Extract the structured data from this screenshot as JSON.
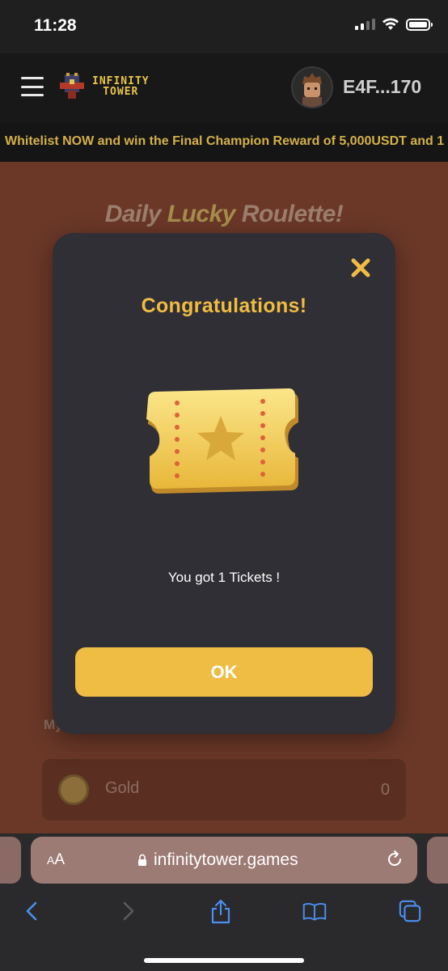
{
  "status_bar": {
    "time": "11:28"
  },
  "header": {
    "logo_line1": "INFINITY",
    "logo_line2": "TOWER",
    "wallet_address": "E4F...170"
  },
  "ticker": {
    "text": "Whitelist NOW and win the Final Champion Reward of 5,000USDT and 1"
  },
  "page": {
    "title_part1": "Daily ",
    "title_part2": "Lucky",
    "title_part3": " Roulette!",
    "my_label": "My",
    "gold_label": "Gold",
    "gold_value": "0"
  },
  "modal": {
    "title": "Congratulations!",
    "message": "You got 1 Tickets !",
    "ok_label": "OK"
  },
  "browser": {
    "aa_label_small": "A",
    "aa_label_big": "A",
    "url": "infinitytower.games"
  },
  "colors": {
    "accent_yellow": "#efbc44",
    "modal_bg": "#2f2f35",
    "page_bg": "#6b3828"
  }
}
